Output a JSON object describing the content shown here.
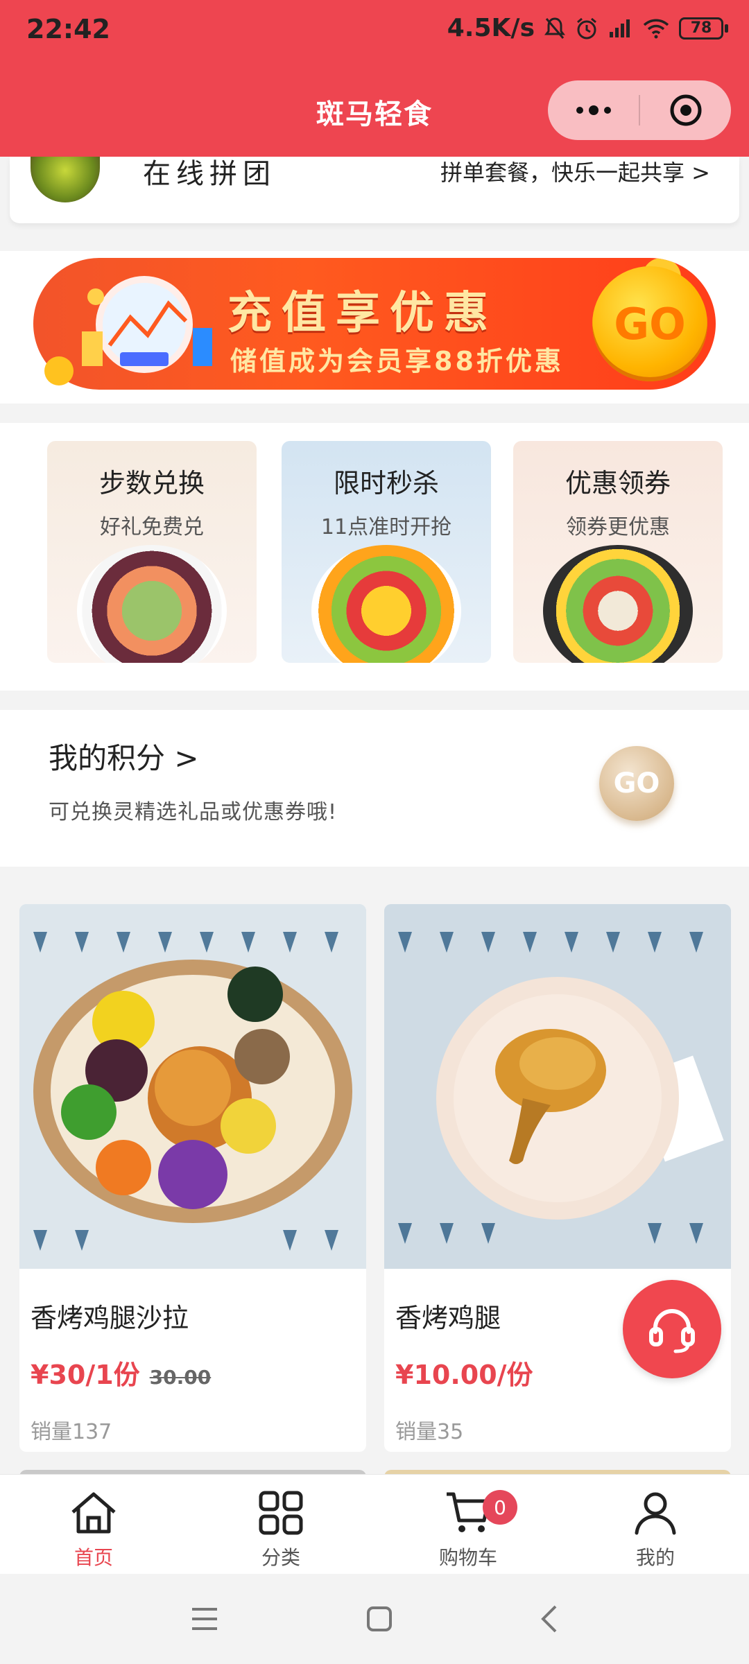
{
  "status_bar": {
    "time": "22:42",
    "network_speed": "4.5K/s",
    "battery": "78"
  },
  "header": {
    "title": "斑马轻食",
    "capsule_more_icon": "more-dots-icon",
    "capsule_close_icon": "target-icon"
  },
  "group_buy": {
    "title": "在线拼团",
    "desc": "拼单套餐，快乐一起共享 >"
  },
  "banner": {
    "main": "充值享优惠",
    "sub": "储值成为会员享88折优惠",
    "go": "GO"
  },
  "features": [
    {
      "title": "步数兑换",
      "sub": "好礼免费兑"
    },
    {
      "title": "限时秒杀",
      "sub": "11点准时开抢"
    },
    {
      "title": "优惠领券",
      "sub": "领券更优惠"
    }
  ],
  "points": {
    "title": "我的积分 >",
    "desc": "可兑换灵精选礼品或优惠券哦!",
    "go": "GO"
  },
  "products": [
    {
      "name": "香烤鸡腿沙拉",
      "price": "¥30/1份",
      "old_price": "30.00",
      "sales": "销量137"
    },
    {
      "name": "香烤鸡腿",
      "price": "¥10.00/份",
      "old_price": "",
      "sales": "销量35"
    }
  ],
  "tabbar": {
    "items": [
      {
        "label": "首页",
        "icon": "home-icon"
      },
      {
        "label": "分类",
        "icon": "grid-icon"
      },
      {
        "label": "购物车",
        "icon": "cart-icon"
      },
      {
        "label": "我的",
        "icon": "user-icon"
      }
    ],
    "cart_count": "0"
  },
  "colors": {
    "brand": "#ee4550",
    "price": "#e8454f"
  }
}
